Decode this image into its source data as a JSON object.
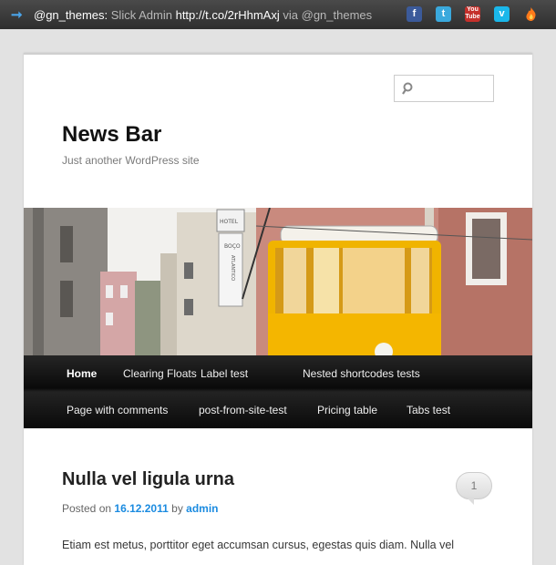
{
  "newsbar": {
    "handle": "@gn_themes:",
    "text": "Slick Admin",
    "link": "http://t.co/2rHhmAxj",
    "via": "via",
    "via_handle": "@gn_themes",
    "social_icons": [
      "facebook-icon",
      "twitter-icon",
      "youtube-icon",
      "vimeo-icon",
      "rss-icon"
    ]
  },
  "site": {
    "title": "News Bar",
    "description": "Just another WordPress site"
  },
  "menu": {
    "items": [
      "Home",
      "Clearing Floats",
      "Label test",
      "Nested shortcodes tests",
      "Page with comments",
      "post-from-site-test",
      "Pricing table",
      "Tabs test"
    ],
    "active": "Home"
  },
  "post": {
    "title": "Nulla vel ligula urna",
    "posted_on": "Posted on",
    "date": "16.12.2011",
    "by": "by",
    "author": "admin",
    "comments": "1",
    "excerpt": "Etiam est metus, porttitor eget accumsan cursus, egestas quis diam. Nulla vel"
  },
  "header_image_text": [
    "HOTEL",
    "BOÇO",
    "ATLANTICO"
  ],
  "colors": {
    "link": "#1b8be0",
    "tram": "#f0b400",
    "newsbar": "#3a3a3a",
    "menu": "#111111"
  }
}
